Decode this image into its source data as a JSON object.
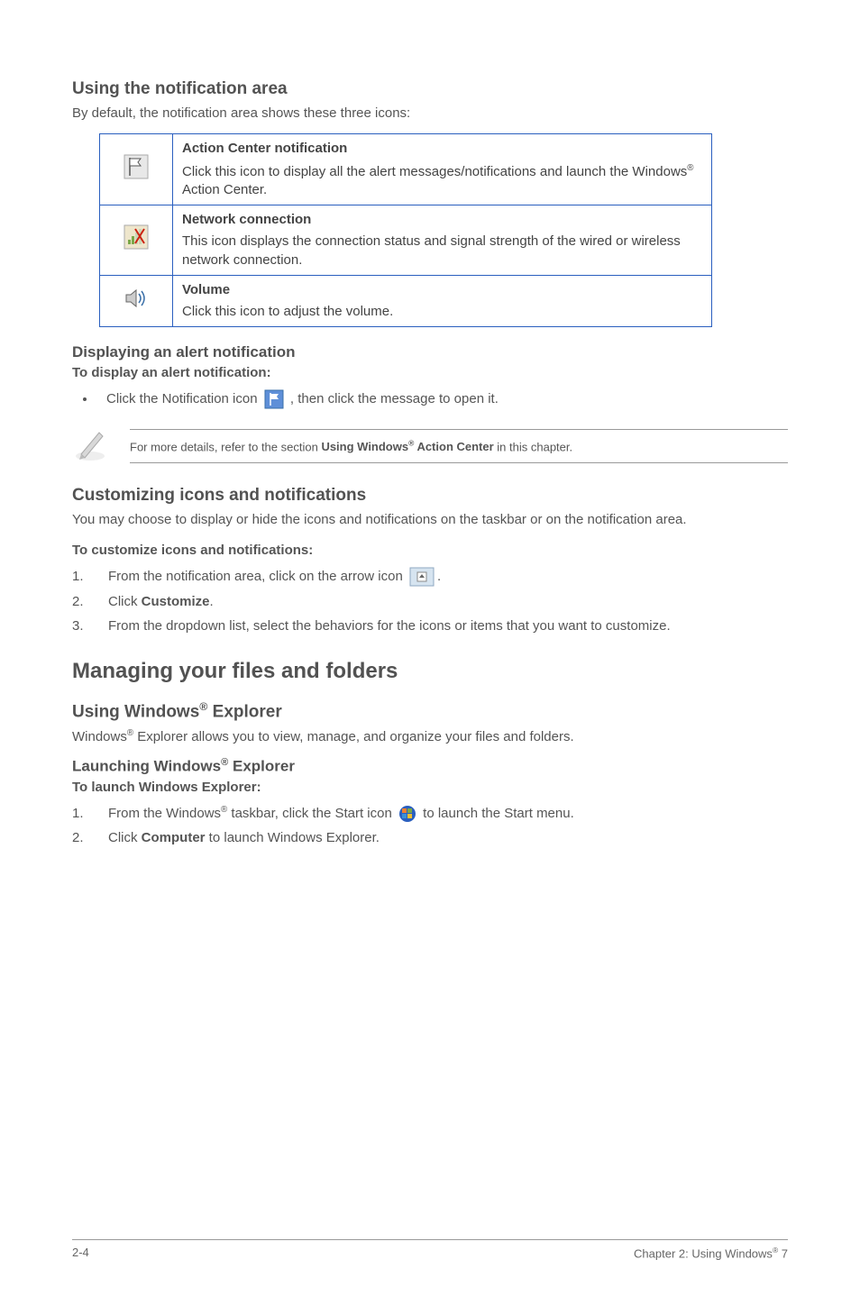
{
  "section1": {
    "heading": "Using the notification area",
    "intro": "By default, the notification area shows these three icons:"
  },
  "table": {
    "rows": [
      {
        "title": "Action Center notification",
        "desc_pre": "Click this icon to display all the alert messages/notifications and launch the Windows",
        "desc_post": " Action Center."
      },
      {
        "title": "Network connection",
        "desc": "This icon displays the connection status and signal strength of the wired or wireless network connection."
      },
      {
        "title": "Volume",
        "desc": "Click this icon to adjust the volume."
      }
    ]
  },
  "alert": {
    "heading": "Displaying an alert notification",
    "sub": "To display an alert notification:",
    "bullet_pre": "Click the Notification icon ",
    "bullet_post": ", then click the message to open it."
  },
  "note": {
    "pre": "For more details, refer to the section ",
    "bold_pre": "Using Windows",
    "bold_post": " Action Center",
    "post": " in this chapter."
  },
  "custom": {
    "heading": "Customizing icons and notifications",
    "para": "You may choose to display or hide the icons and notifications on the taskbar or on the notification area.",
    "sub": "To customize icons and notifications:",
    "steps": [
      {
        "num": "1.",
        "pre": "From the notification area, click on the arrow icon ",
        "post": "."
      },
      {
        "num": "2.",
        "pre": "Click ",
        "bold": "Customize",
        "post": "."
      },
      {
        "num": "3.",
        "text": "From the dropdown list, select the behaviors for the icons or items that you want to customize."
      }
    ]
  },
  "managing": {
    "heading": "Managing your files and folders"
  },
  "explorer": {
    "heading_pre": "Using Windows",
    "heading_post": " Explorer",
    "para_pre": "Windows",
    "para_post": " Explorer allows you to view, manage, and organize your files and folders.",
    "launch_heading_pre": "Launching Windows",
    "launch_heading_post": " Explorer",
    "launch_sub": "To launch Windows Explorer:",
    "steps": [
      {
        "num": "1.",
        "pre_a": "From the Windows",
        "pre_b": " taskbar, click the Start icon ",
        "post": " to launch the Start menu."
      },
      {
        "num": "2.",
        "pre": "Click ",
        "bold": "Computer",
        "post": " to launch Windows Explorer."
      }
    ]
  },
  "footer": {
    "left": "2-4",
    "right_pre": "Chapter 2: Using Windows",
    "right_post": " 7"
  },
  "reg": "®"
}
